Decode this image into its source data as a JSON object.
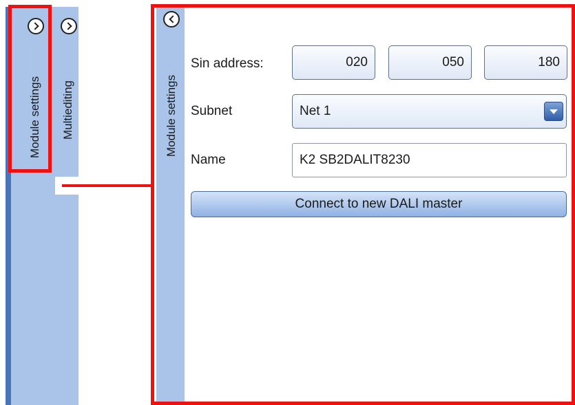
{
  "collapsed_strip": {
    "tabs": [
      {
        "label": "Module settings",
        "icon": "chevron-right-icon"
      },
      {
        "label": "Multiediting",
        "icon": "chevron-right-icon"
      }
    ]
  },
  "panel": {
    "tab_label": "Module settings",
    "collapse_icon": "chevron-left-icon",
    "sin_address": {
      "label": "Sin address:",
      "values": [
        "020",
        "050",
        "180"
      ]
    },
    "subnet": {
      "label": "Subnet",
      "selected": "Net 1"
    },
    "name": {
      "label": "Name",
      "value": "K2 SB2DALIT8230"
    },
    "connect_button": "Connect to new DALI master"
  },
  "colors": {
    "highlight": "#ee1111",
    "tab_strip": "#a9c4e8",
    "strip_edge": "#4a74b8"
  }
}
